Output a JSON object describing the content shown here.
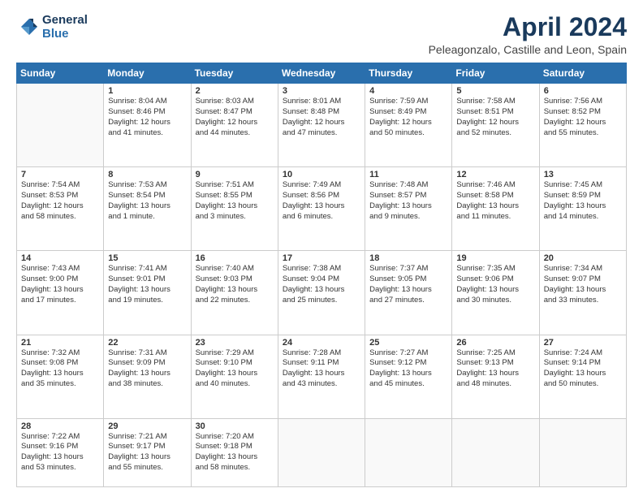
{
  "logo": {
    "line1": "General",
    "line2": "Blue"
  },
  "title": "April 2024",
  "subtitle": "Peleagonzalo, Castille and Leon, Spain",
  "days_header": [
    "Sunday",
    "Monday",
    "Tuesday",
    "Wednesday",
    "Thursday",
    "Friday",
    "Saturday"
  ],
  "weeks": [
    [
      {
        "day": "",
        "info": ""
      },
      {
        "day": "1",
        "info": "Sunrise: 8:04 AM\nSunset: 8:46 PM\nDaylight: 12 hours\nand 41 minutes."
      },
      {
        "day": "2",
        "info": "Sunrise: 8:03 AM\nSunset: 8:47 PM\nDaylight: 12 hours\nand 44 minutes."
      },
      {
        "day": "3",
        "info": "Sunrise: 8:01 AM\nSunset: 8:48 PM\nDaylight: 12 hours\nand 47 minutes."
      },
      {
        "day": "4",
        "info": "Sunrise: 7:59 AM\nSunset: 8:49 PM\nDaylight: 12 hours\nand 50 minutes."
      },
      {
        "day": "5",
        "info": "Sunrise: 7:58 AM\nSunset: 8:51 PM\nDaylight: 12 hours\nand 52 minutes."
      },
      {
        "day": "6",
        "info": "Sunrise: 7:56 AM\nSunset: 8:52 PM\nDaylight: 12 hours\nand 55 minutes."
      }
    ],
    [
      {
        "day": "7",
        "info": "Sunrise: 7:54 AM\nSunset: 8:53 PM\nDaylight: 12 hours\nand 58 minutes."
      },
      {
        "day": "8",
        "info": "Sunrise: 7:53 AM\nSunset: 8:54 PM\nDaylight: 13 hours\nand 1 minute."
      },
      {
        "day": "9",
        "info": "Sunrise: 7:51 AM\nSunset: 8:55 PM\nDaylight: 13 hours\nand 3 minutes."
      },
      {
        "day": "10",
        "info": "Sunrise: 7:49 AM\nSunset: 8:56 PM\nDaylight: 13 hours\nand 6 minutes."
      },
      {
        "day": "11",
        "info": "Sunrise: 7:48 AM\nSunset: 8:57 PM\nDaylight: 13 hours\nand 9 minutes."
      },
      {
        "day": "12",
        "info": "Sunrise: 7:46 AM\nSunset: 8:58 PM\nDaylight: 13 hours\nand 11 minutes."
      },
      {
        "day": "13",
        "info": "Sunrise: 7:45 AM\nSunset: 8:59 PM\nDaylight: 13 hours\nand 14 minutes."
      }
    ],
    [
      {
        "day": "14",
        "info": "Sunrise: 7:43 AM\nSunset: 9:00 PM\nDaylight: 13 hours\nand 17 minutes."
      },
      {
        "day": "15",
        "info": "Sunrise: 7:41 AM\nSunset: 9:01 PM\nDaylight: 13 hours\nand 19 minutes."
      },
      {
        "day": "16",
        "info": "Sunrise: 7:40 AM\nSunset: 9:03 PM\nDaylight: 13 hours\nand 22 minutes."
      },
      {
        "day": "17",
        "info": "Sunrise: 7:38 AM\nSunset: 9:04 PM\nDaylight: 13 hours\nand 25 minutes."
      },
      {
        "day": "18",
        "info": "Sunrise: 7:37 AM\nSunset: 9:05 PM\nDaylight: 13 hours\nand 27 minutes."
      },
      {
        "day": "19",
        "info": "Sunrise: 7:35 AM\nSunset: 9:06 PM\nDaylight: 13 hours\nand 30 minutes."
      },
      {
        "day": "20",
        "info": "Sunrise: 7:34 AM\nSunset: 9:07 PM\nDaylight: 13 hours\nand 33 minutes."
      }
    ],
    [
      {
        "day": "21",
        "info": "Sunrise: 7:32 AM\nSunset: 9:08 PM\nDaylight: 13 hours\nand 35 minutes."
      },
      {
        "day": "22",
        "info": "Sunrise: 7:31 AM\nSunset: 9:09 PM\nDaylight: 13 hours\nand 38 minutes."
      },
      {
        "day": "23",
        "info": "Sunrise: 7:29 AM\nSunset: 9:10 PM\nDaylight: 13 hours\nand 40 minutes."
      },
      {
        "day": "24",
        "info": "Sunrise: 7:28 AM\nSunset: 9:11 PM\nDaylight: 13 hours\nand 43 minutes."
      },
      {
        "day": "25",
        "info": "Sunrise: 7:27 AM\nSunset: 9:12 PM\nDaylight: 13 hours\nand 45 minutes."
      },
      {
        "day": "26",
        "info": "Sunrise: 7:25 AM\nSunset: 9:13 PM\nDaylight: 13 hours\nand 48 minutes."
      },
      {
        "day": "27",
        "info": "Sunrise: 7:24 AM\nSunset: 9:14 PM\nDaylight: 13 hours\nand 50 minutes."
      }
    ],
    [
      {
        "day": "28",
        "info": "Sunrise: 7:22 AM\nSunset: 9:16 PM\nDaylight: 13 hours\nand 53 minutes."
      },
      {
        "day": "29",
        "info": "Sunrise: 7:21 AM\nSunset: 9:17 PM\nDaylight: 13 hours\nand 55 minutes."
      },
      {
        "day": "30",
        "info": "Sunrise: 7:20 AM\nSunset: 9:18 PM\nDaylight: 13 hours\nand 58 minutes."
      },
      {
        "day": "",
        "info": ""
      },
      {
        "day": "",
        "info": ""
      },
      {
        "day": "",
        "info": ""
      },
      {
        "day": "",
        "info": ""
      }
    ]
  ]
}
